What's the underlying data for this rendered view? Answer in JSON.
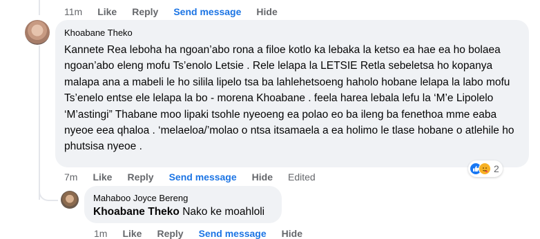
{
  "top_actions": {
    "time": "11m",
    "like": "Like",
    "reply": "Reply",
    "send_message": "Send message",
    "hide": "Hide"
  },
  "comment": {
    "author": "Khoabane Theko",
    "text": "Kannete Rea leboha ha ngoan’abo rona a filoe kotlo ka lebaka la ketso ea hae ea ho bolaea ngoan’abo eleng mofu Ts’enolo Letsie . Rele lelapa la LETSIE Retla sebeletsa ho kopanya malapa ana a mabeli le ho silila lipelo tsa ba lahlehetsoeng haholo hobane lelapa la labo mofu Ts’enelo entse ele lelapa la bo - morena Khoabane . feela harea lebala lefu la ‘M’e Lipolelo ‘M’astingi” Thabane moo lipaki tsohle nyeoeng ea polao eo ba ileng ba fenethoa mme eaba nyeoe eea qhaloa . ‘melaeloa/’molao o ntsa itsamaela a ea holimo le tlase hobane o atlehile ho phutsisa nyeoe .",
    "actions": {
      "time": "7m",
      "like": "Like",
      "reply": "Reply",
      "send_message": "Send message",
      "hide": "Hide",
      "edited": "Edited"
    },
    "reactions": {
      "icons": [
        "like-icon",
        "care-icon"
      ],
      "count": "2",
      "colors": {
        "like": "#1877f2",
        "care": "#f7b125"
      }
    }
  },
  "reply": {
    "author": "Mahaboo Joyce Bereng",
    "mention": "Khoabane Theko",
    "text": "Nako ke moahloli",
    "actions": {
      "time": "1m",
      "like": "Like",
      "reply": "Reply",
      "send_message": "Send message",
      "hide": "Hide"
    }
  },
  "colors": {
    "bubble": "#f0f2f5",
    "link": "#1b74e4",
    "muted": "#65676b"
  }
}
